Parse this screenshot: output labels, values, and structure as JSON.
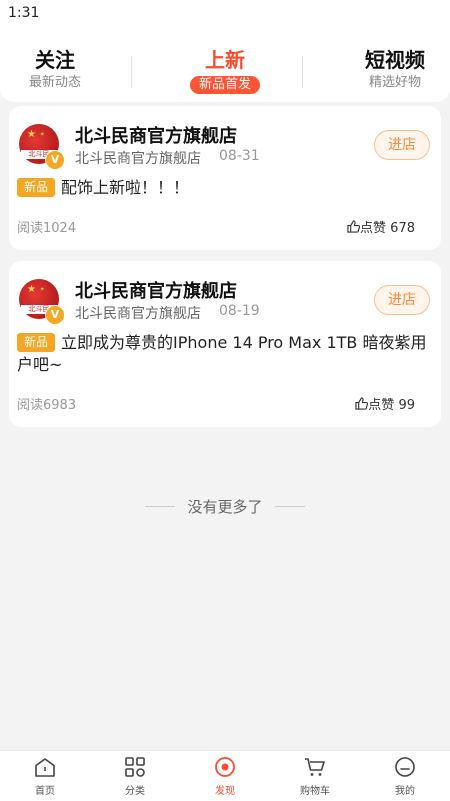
{
  "statusbar": {
    "time": "1:31"
  },
  "tabs": [
    {
      "title": "关注",
      "sub": "最新动态"
    },
    {
      "title": "上新",
      "sub": "新品首发"
    },
    {
      "title": "短视频",
      "sub": "精选好物"
    }
  ],
  "cards": [
    {
      "logo_text": "北斗民",
      "store_name": "北斗民商官方旗舰店",
      "store_sub": "北斗民商官方旗舰店",
      "date": "08-31",
      "enter": "进店",
      "badge": "新品",
      "text": "配饰上新啦！！！",
      "reads": "阅读1024",
      "like_label": "点赞",
      "likes": "678"
    },
    {
      "logo_text": "北斗民",
      "store_name": "北斗民商官方旗舰店",
      "store_sub": "北斗民商官方旗舰店",
      "date": "08-19",
      "enter": "进店",
      "badge": "新品",
      "text": "立即成为尊贵的IPhone 14 Pro Max 1TB 暗夜紫用户吧~",
      "reads": "阅读6983",
      "like_label": "点赞",
      "likes": "99"
    }
  ],
  "footer_text": "没有更多了",
  "bottomnav": [
    {
      "label": "首页",
      "icon": "home-icon"
    },
    {
      "label": "分类",
      "icon": "category-icon"
    },
    {
      "label": "发现",
      "icon": "discover-icon"
    },
    {
      "label": "购物车",
      "icon": "cart-icon"
    },
    {
      "label": "我的",
      "icon": "profile-icon"
    }
  ],
  "colors": {
    "accent": "#ff4a2f",
    "badge": "#f5a623",
    "enter": "#ff8a3c"
  }
}
